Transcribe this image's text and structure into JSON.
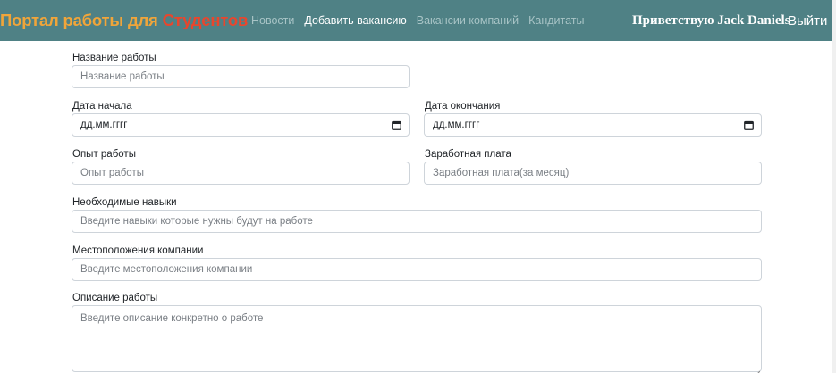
{
  "header": {
    "brand_part1": "Портал работы для ",
    "brand_part2": "Студентов",
    "nav": [
      {
        "label": "Новости",
        "active": false
      },
      {
        "label": "Добавить вакансию",
        "active": true
      },
      {
        "label": "Вакансии компаний",
        "active": false
      },
      {
        "label": "Кандитаты",
        "active": false
      }
    ],
    "greeting": "Приветствую Jack Daniels",
    "logout": "Выйти"
  },
  "form": {
    "job_title": {
      "label": "Название работы",
      "placeholder": "Название работы"
    },
    "start_date": {
      "label": "Дата начала",
      "value": "дд.мм.гггг"
    },
    "end_date": {
      "label": "Дата окончания",
      "value": "дд.мм.гггг"
    },
    "experience": {
      "label": "Опыт работы",
      "placeholder": "Опыт работы"
    },
    "salary": {
      "label": "Заработная плата",
      "placeholder": "Заработная плата(за месяц)"
    },
    "skills": {
      "label": "Необходимые навыки",
      "placeholder": "Введите навыки которые нужны будут на работе"
    },
    "location": {
      "label": "Местоположения компании",
      "placeholder": "Введите местоположения компании"
    },
    "description": {
      "label": "Описание работы",
      "placeholder": "Введите описание конкретно о работе"
    }
  },
  "colors": {
    "navbar": "#4f8185",
    "brand_orange": "#f0a53a",
    "brand_red": "#e8462d"
  },
  "icons": {
    "date_picker": "calendar-icon"
  }
}
